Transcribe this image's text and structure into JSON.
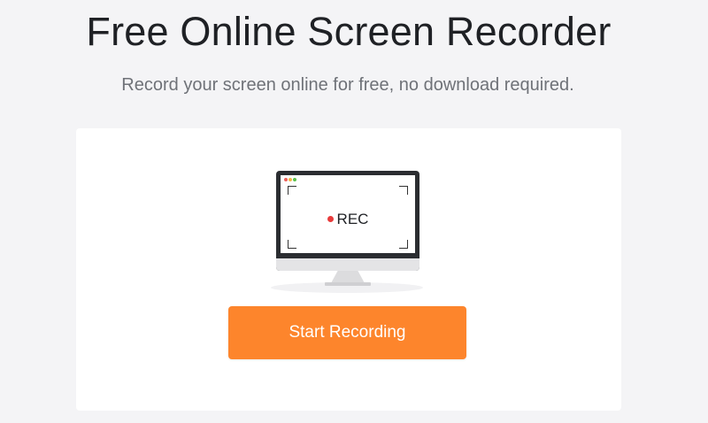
{
  "header": {
    "title": "Free Online Screen Recorder",
    "subtitle": "Record your screen online for free, no download required."
  },
  "card": {
    "illustration": {
      "rec_label": "REC",
      "icons": [
        "monitor-icon",
        "recording-dot-icon",
        "window-dots-icon"
      ]
    },
    "start_button_label": "Start Recording"
  },
  "colors": {
    "background": "#f4f4f6",
    "accent": "#fd852c",
    "rec_dot": "#e83b3b"
  }
}
